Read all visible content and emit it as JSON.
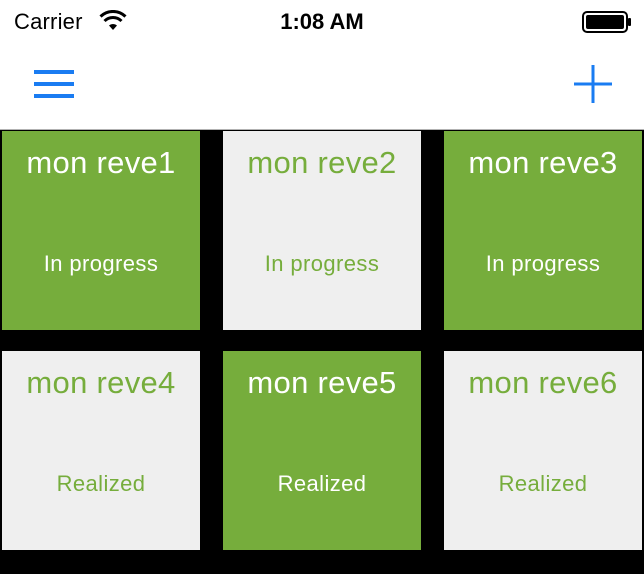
{
  "status_bar": {
    "carrier": "Carrier",
    "time": "1:08 AM",
    "icons": [
      "wifi-icon",
      "battery-icon"
    ]
  },
  "nav_bar": {
    "left_icon": "menu-icon",
    "right_icon": "plus-icon",
    "accent_color": "#1a7cf2"
  },
  "colors": {
    "tile_green": "#76ad3c",
    "tile_light": "#efefef",
    "background": "#000000"
  },
  "dreams": [
    {
      "title": "mon reve1",
      "status": "In progress",
      "style": "green"
    },
    {
      "title": "mon reve2",
      "status": "In progress",
      "style": "light"
    },
    {
      "title": "mon reve3",
      "status": "In progress",
      "style": "green"
    },
    {
      "title": "mon reve4",
      "status": "Realized",
      "style": "light"
    },
    {
      "title": "mon reve5",
      "status": "Realized",
      "style": "green"
    },
    {
      "title": "mon reve6",
      "status": "Realized",
      "style": "light"
    }
  ]
}
